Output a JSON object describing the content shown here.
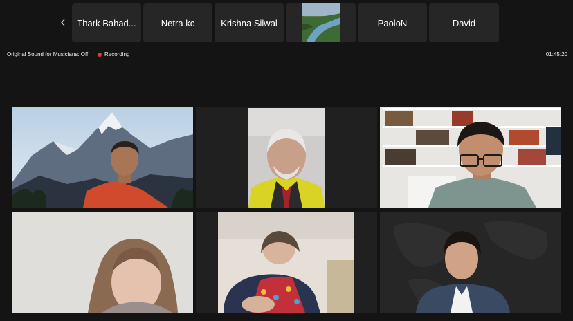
{
  "participants_strip": {
    "prev_icon": "chevron-left-icon",
    "names": [
      "Thark Bahad...",
      "Netra kc",
      "Krishna Silwal",
      "PaoloN",
      "David"
    ]
  },
  "status_bar": {
    "sound": "Original Sound for Musicians: Off",
    "recording": "Recording",
    "recording_color": "#e03c31",
    "timer": "01:45:20"
  },
  "active_speaker_color": "#3fbf4a"
}
